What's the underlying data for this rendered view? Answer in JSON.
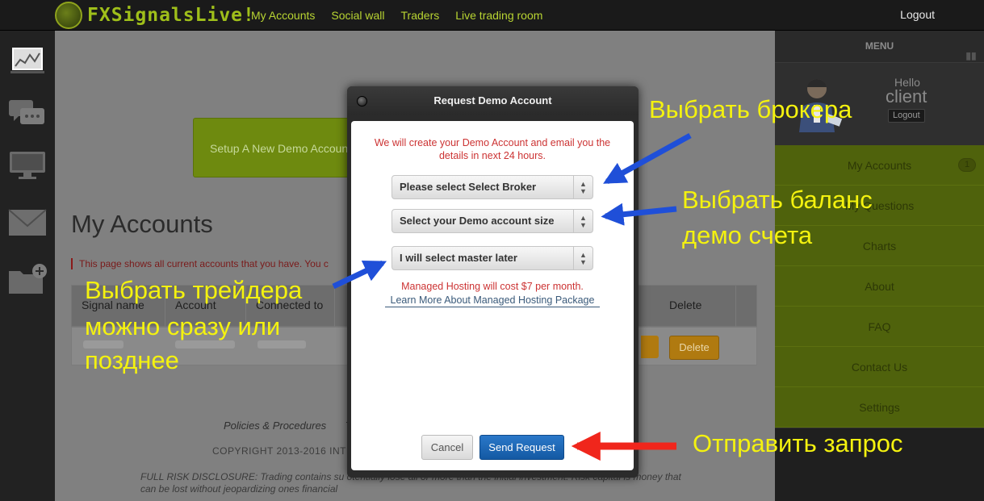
{
  "header": {
    "logo_text": "FXSignalsLive!",
    "nav": [
      "My Accounts",
      "Social wall",
      "Traders",
      "Live trading room"
    ],
    "logout": "Logout"
  },
  "rail": {
    "icons": [
      "chart-thumbnail-icon",
      "chat-bubbles-icon",
      "monitor-icon",
      "envelope-icon",
      "add-folder-icon"
    ]
  },
  "main": {
    "setup_button": "Setup A New Demo Account",
    "page_title": "My Accounts",
    "page_desc": "This page shows all current accounts that you have. You c",
    "table": {
      "headers": [
        "Signal name",
        "Account",
        "Connected to",
        "Delete"
      ],
      "delete_button": "Delete"
    },
    "footer_links": [
      "Policies & Procedures",
      "T"
    ],
    "copyright": "COPYRIGHT 2013-2016 INTE",
    "disclosure": "FULL RISK DISCLOSURE: Trading contains su                                                                        otentially lose all or more than the initial investment. Risk capital is money that can be lost without jeopardizing ones financial"
  },
  "menu": {
    "title": "MENU",
    "hello": "Hello",
    "user": "client",
    "logout": "Logout",
    "items": [
      {
        "label": "My Accounts",
        "badge": "1"
      },
      {
        "label": "My Questions"
      },
      {
        "label": "Charts"
      },
      {
        "label": "About"
      },
      {
        "label": "FAQ"
      },
      {
        "label": "Contact Us"
      },
      {
        "label": "Settings"
      }
    ]
  },
  "modal": {
    "title": "Request Demo Account",
    "intro": "We will create your Demo Account and email you the details in next 24 hours.",
    "broker_select": "Please select Select Broker",
    "size_select": "Select your Demo account size",
    "master_select": "I will select master later",
    "hosting_cost": "Managed Hosting will cost $7 per month.",
    "hosting_link": "Learn More About Managed Hosting Package",
    "cancel": "Cancel",
    "send": "Send Request"
  },
  "annotations": {
    "broker": "Выбрать брокера",
    "balance_line1": "Выбрать баланс",
    "balance_line2": "демо счета",
    "trader_line1": "Выбрать трейдера",
    "trader_line2": "можно сразу или",
    "trader_line3": "позднее",
    "send": "Отправить запрос",
    "arrow_color_blue": "#1f4fd8",
    "arrow_color_red": "#f0261c",
    "text_color": "#f4f20f"
  }
}
